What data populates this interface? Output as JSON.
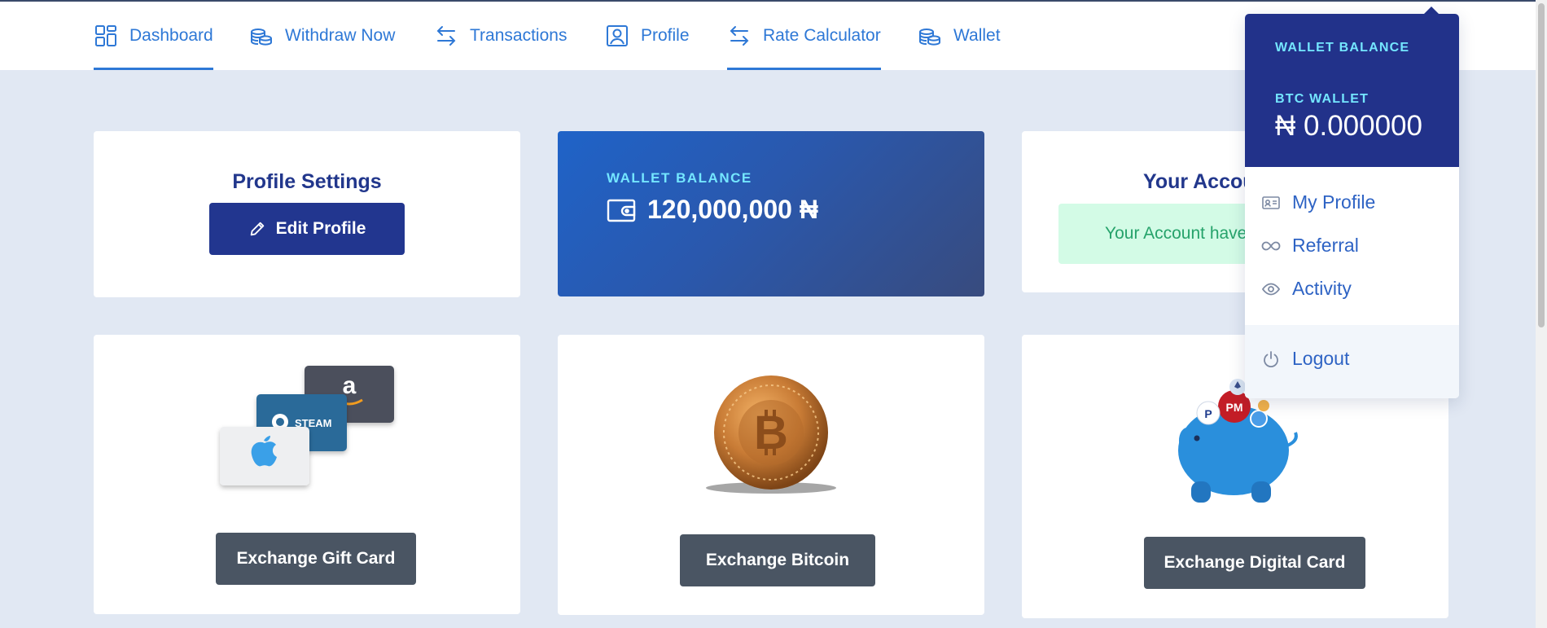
{
  "nav": {
    "items": [
      {
        "label": "Dashboard",
        "icon": "dashboard-icon",
        "active": true
      },
      {
        "label": "Withdraw Now",
        "icon": "coins-icon",
        "active": false
      },
      {
        "label": "Transactions",
        "icon": "transfer-arrows-icon",
        "active": false
      },
      {
        "label": "Profile",
        "icon": "user-portrait-icon",
        "active": false
      },
      {
        "label": "Rate Calculator",
        "icon": "transfer-arrows-icon",
        "active": true
      },
      {
        "label": "Wallet",
        "icon": "coins-icon",
        "active": false
      }
    ]
  },
  "profile_settings": {
    "title": "Profile Settings",
    "edit_button": "Edit Profile"
  },
  "wallet_card": {
    "label": "WALLET BALANCE",
    "amount": "120,000,000 ₦"
  },
  "account": {
    "title": "Your Account",
    "alert": "Your Account have been verified"
  },
  "actions": {
    "gift_card": "Exchange Gift Card",
    "bitcoin": "Exchange Bitcoin",
    "digital_card": "Exchange Digital Card"
  },
  "gift_card_brands": {
    "steam": "STEAM",
    "apple": "apple-logo",
    "amazon": "amazon-logo"
  },
  "digital_card_art": {
    "pm": "PM"
  },
  "dropdown": {
    "header_label": "WALLET BALANCE",
    "btc_label": "BTC WALLET",
    "btc_amount": "₦ 0.000000",
    "items": [
      {
        "label": "My Profile",
        "icon": "id-card-icon"
      },
      {
        "label": "Referral",
        "icon": "infinity-icon"
      },
      {
        "label": "Activity",
        "icon": "eye-icon"
      }
    ],
    "logout": "Logout"
  },
  "colors": {
    "primary": "#22368f",
    "accent_blue": "#2e78d6",
    "cyan_label": "#74e6ff",
    "success_bg": "#d3fbe6",
    "success_text": "#26a36b",
    "page_bg": "#e1e8f3",
    "button_dark": "#4a5563"
  }
}
